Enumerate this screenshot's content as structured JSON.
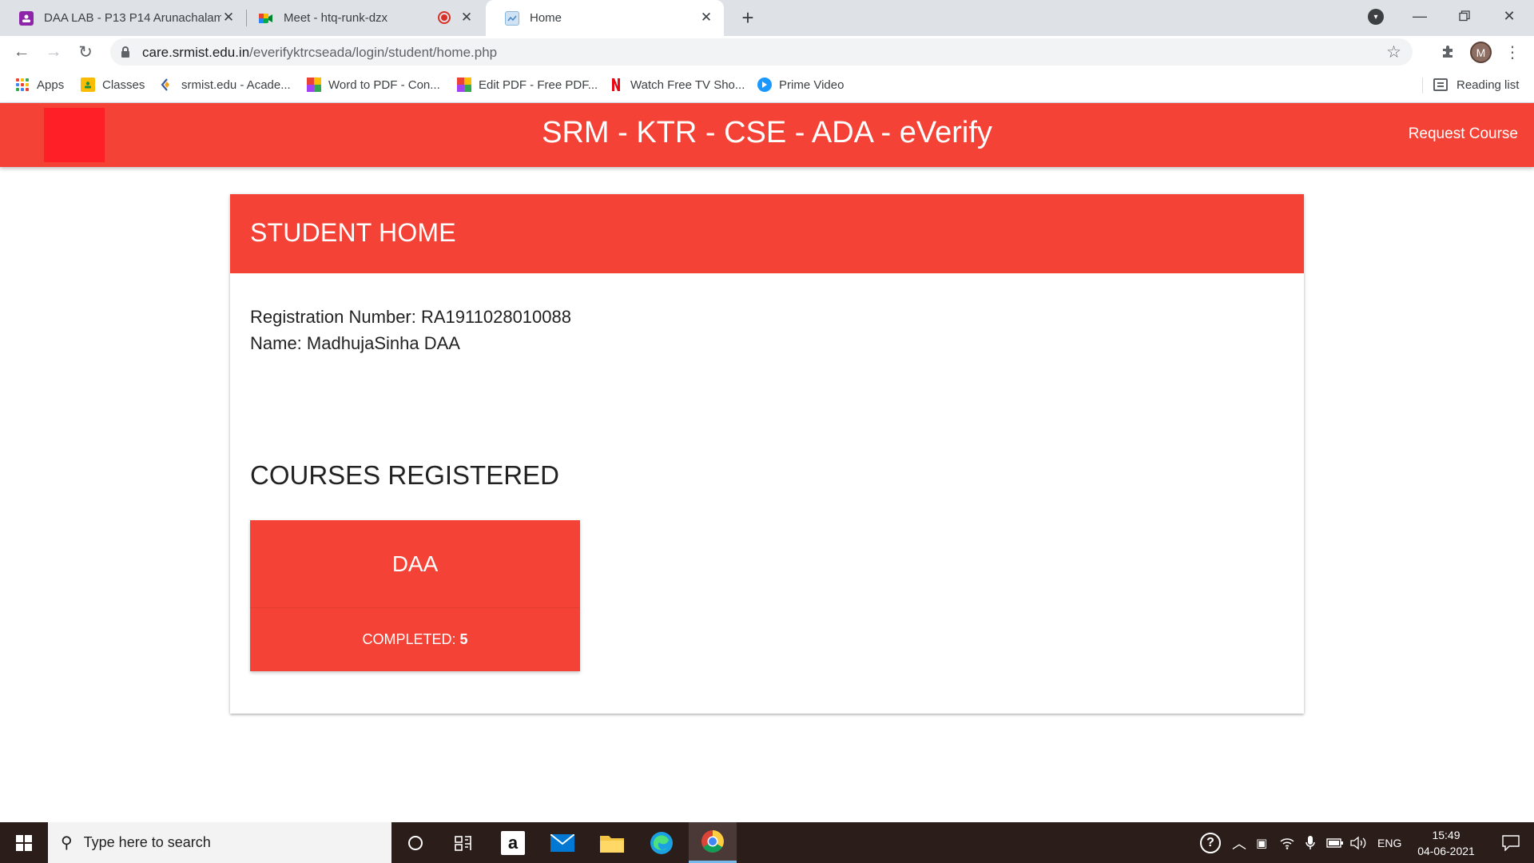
{
  "browser": {
    "tabs": [
      {
        "title": "DAA LAB - P13 P14 Arunachalam",
        "favicon": "classroom-icon",
        "active": false
      },
      {
        "title": "Meet - htq-runk-dzx",
        "favicon": "meet-icon",
        "active": false,
        "recording": true
      },
      {
        "title": "Home",
        "favicon": "page-icon",
        "active": true
      }
    ],
    "url_host": "care.srmist.edu.in",
    "url_path": "/everifyktrcseada/login/student/home.php",
    "profile_initial": "M",
    "bookmarks": [
      {
        "label": "Apps",
        "icon": "apps-grid-icon"
      },
      {
        "label": "Classes",
        "icon": "classroom-icon"
      },
      {
        "label": "srmist.edu - Acade...",
        "icon": "srm-icon"
      },
      {
        "label": "Word to PDF - Con...",
        "icon": "pdf-tool-icon"
      },
      {
        "label": "Edit PDF - Free PDF...",
        "icon": "pdf-tool-icon"
      },
      {
        "label": "Watch Free TV Sho...",
        "icon": "netflix-icon"
      },
      {
        "label": "Prime Video",
        "icon": "prime-video-icon"
      }
    ],
    "reading_list": "Reading list"
  },
  "app": {
    "title": "SRM - KTR - CSE - ADA - eVerify",
    "request_course": "Request Course",
    "accent_color": "#f44336"
  },
  "card": {
    "heading": "STUDENT HOME",
    "registration_label": "Registration Number:",
    "registration_number": "RA1911028010088",
    "name_label": "Name:",
    "name_value": "MadhujaSinha DAA",
    "courses_heading": "COURSES REGISTERED",
    "courses": [
      {
        "name": "DAA",
        "status_label": "COMPLETED:",
        "status_value": "5"
      }
    ]
  },
  "taskbar": {
    "search_placeholder": "Type here to search",
    "language": "ENG",
    "time": "15:49",
    "date": "04-06-2021"
  }
}
